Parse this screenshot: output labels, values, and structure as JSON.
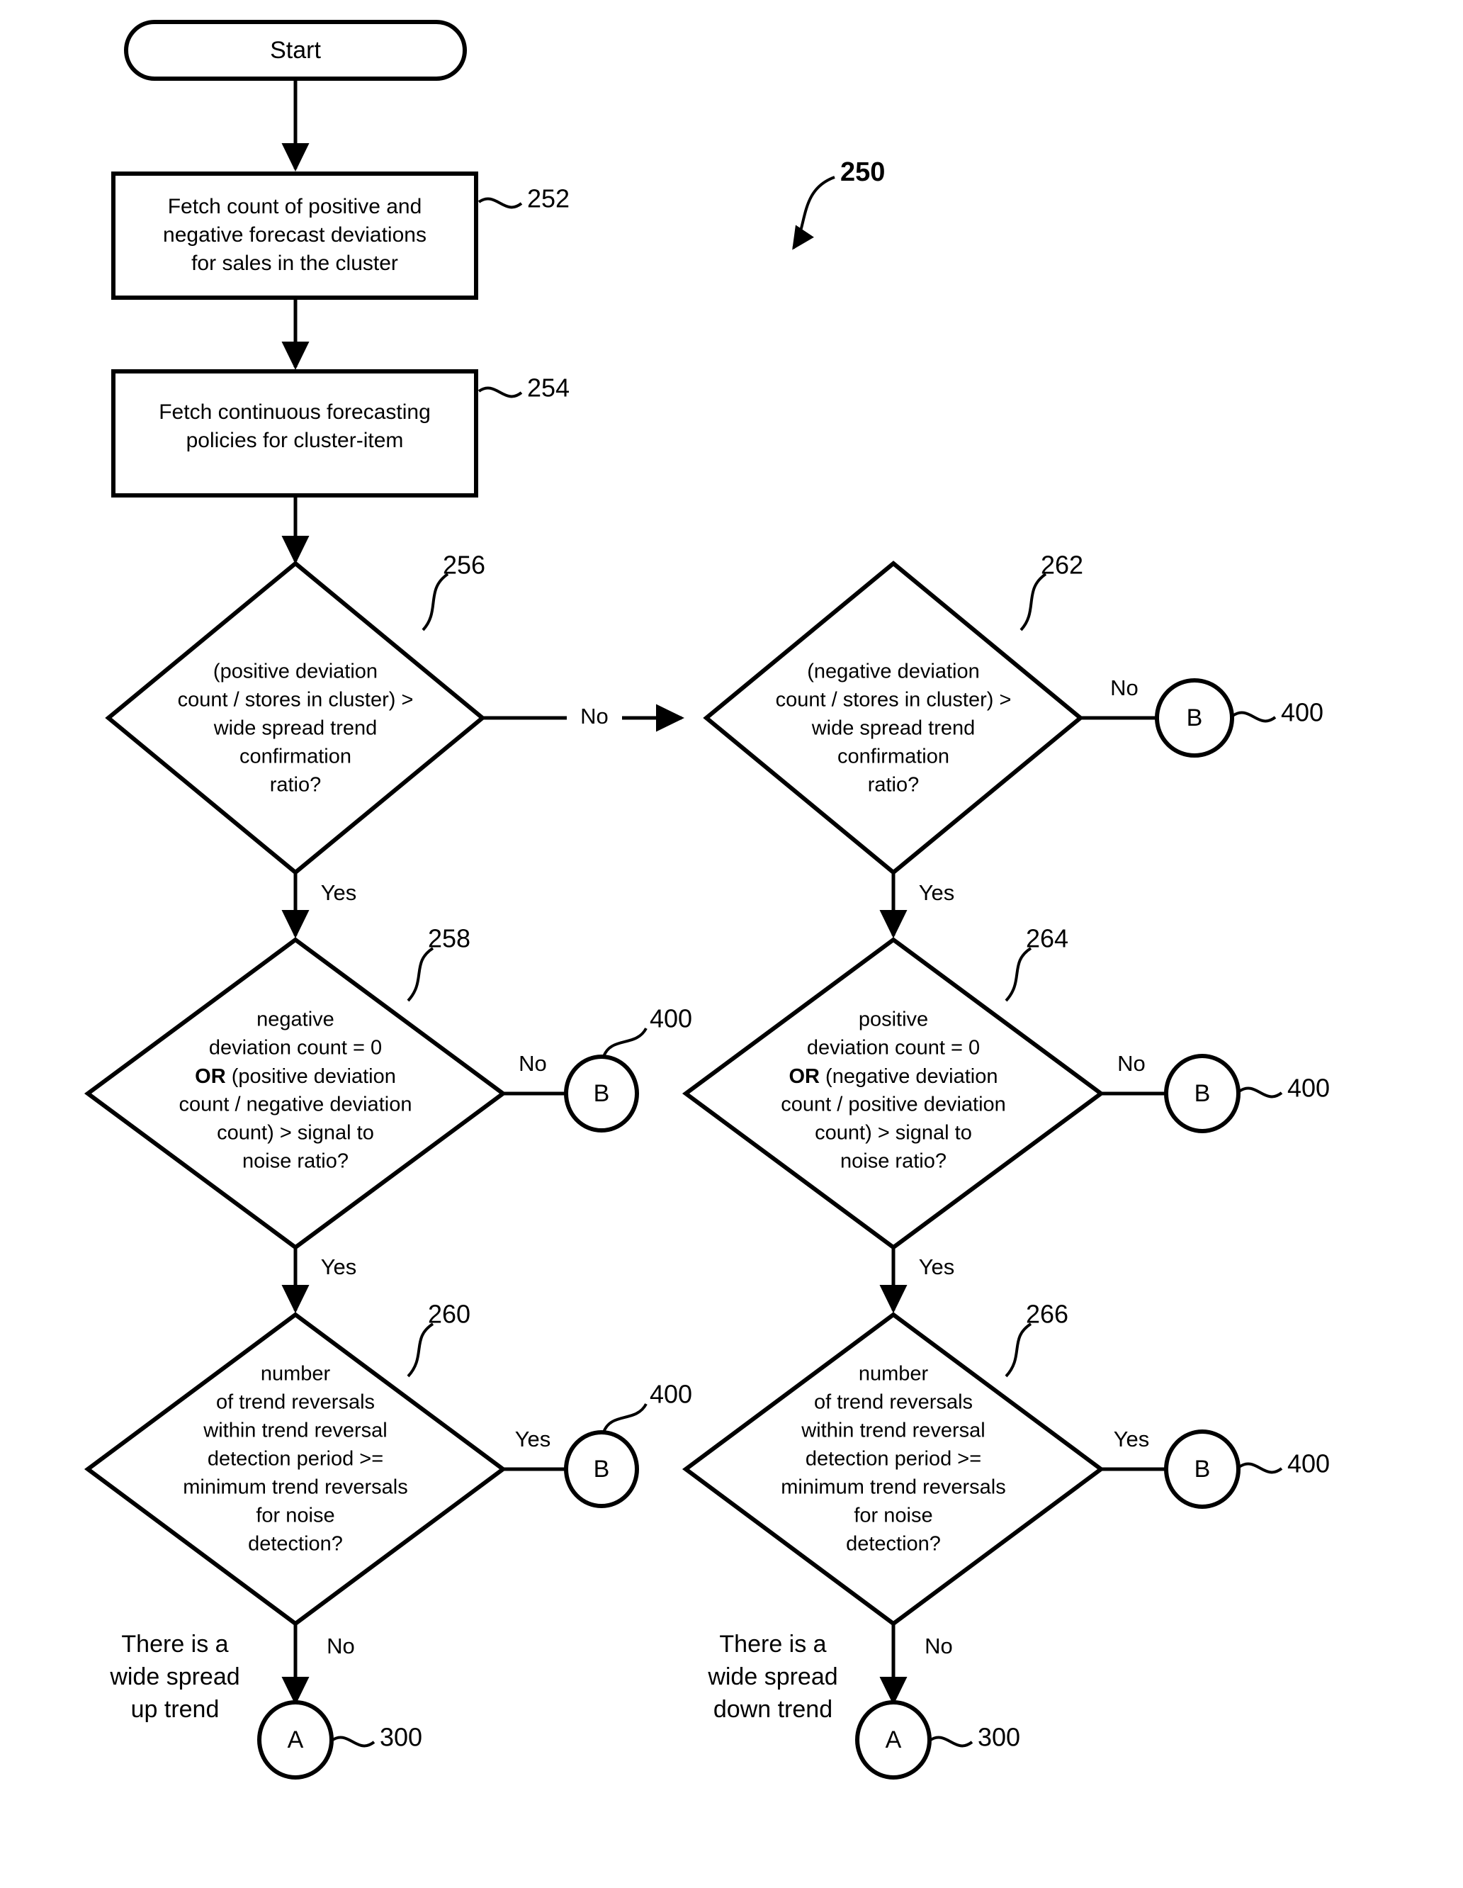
{
  "diagram": {
    "figure_ref": "250",
    "start_node": {
      "label": "Start"
    },
    "process_nodes": [
      {
        "ref": "252",
        "lines": [
          "Fetch count of positive and",
          "negative forecast deviations",
          "for sales in the cluster"
        ]
      },
      {
        "ref": "254",
        "lines": [
          "Fetch continuous forecasting",
          "policies for cluster-item"
        ]
      }
    ],
    "decision_nodes": [
      {
        "ref": "256",
        "lines": [
          "(positive deviation",
          "count / stores in cluster) >",
          "wide spread trend",
          "confirmation",
          "ratio?"
        ],
        "yes_label": "Yes",
        "no_label": "No"
      },
      {
        "ref": "262",
        "lines": [
          "(negative deviation",
          "count / stores in cluster) >",
          "wide spread trend",
          "confirmation",
          "ratio?"
        ],
        "yes_label": "Yes",
        "no_label": "No"
      },
      {
        "ref": "258",
        "lines": [
          "negative",
          "deviation count = 0",
          "OR| (positive deviation",
          "count / negative deviation",
          "count) > signal to",
          "noise ratio?"
        ],
        "yes_label": "Yes",
        "no_label": "No"
      },
      {
        "ref": "264",
        "lines": [
          "positive",
          "deviation count = 0",
          "OR| (negative deviation",
          "count / positive deviation",
          "count) > signal to",
          "noise ratio?"
        ],
        "yes_label": "Yes",
        "no_label": "No"
      },
      {
        "ref": "260",
        "lines": [
          "number",
          "of trend reversals",
          "within trend reversal",
          "detection period >=",
          "minimum trend reversals",
          "for noise",
          "detection?"
        ],
        "yes_label": "Yes",
        "no_label": "No"
      },
      {
        "ref": "266",
        "lines": [
          "number",
          "of trend reversals",
          "within trend reversal",
          "detection period >=",
          "minimum trend reversals",
          "for noise",
          "detection?"
        ],
        "yes_label": "Yes",
        "no_label": "No"
      }
    ],
    "connector_nodes": [
      {
        "id": "b-262-no",
        "letter": "B",
        "ref": "400"
      },
      {
        "id": "b-258-no",
        "letter": "B",
        "ref": "400"
      },
      {
        "id": "b-264-no",
        "letter": "B",
        "ref": "400"
      },
      {
        "id": "b-260-yes",
        "letter": "B",
        "ref": "400"
      },
      {
        "id": "b-266-yes",
        "letter": "B",
        "ref": "400"
      },
      {
        "id": "a-260-no",
        "letter": "A",
        "ref": "300"
      },
      {
        "id": "a-266-no",
        "letter": "A",
        "ref": "300"
      }
    ],
    "annotations": [
      {
        "id": "up-trend",
        "lines": [
          "There is a",
          "wide spread",
          "up trend"
        ]
      },
      {
        "id": "down-trend",
        "lines": [
          "There is a",
          "wide spread",
          "down trend"
        ]
      }
    ]
  }
}
